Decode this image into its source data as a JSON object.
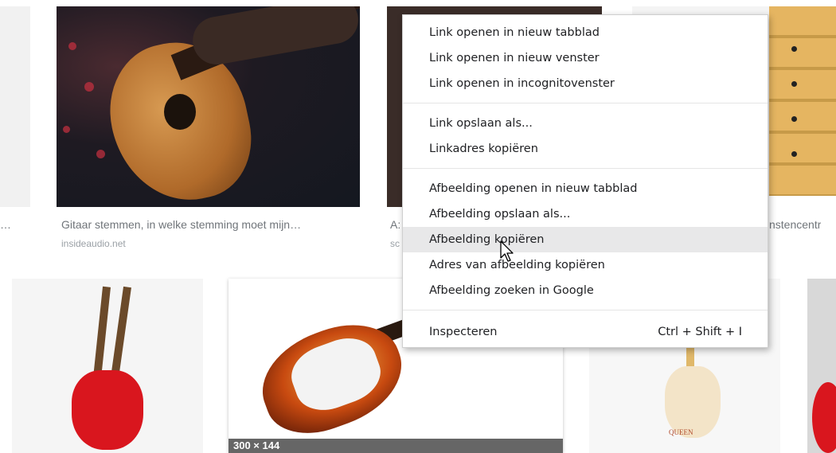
{
  "results": {
    "items": [
      {
        "caption": "…"
      },
      {
        "caption": "Gitaar stemmen, in welke stemming moet mijn…",
        "source": "insideaudio.net"
      },
      {
        "caption": "A:",
        "source": "sc"
      },
      {
        "caption": "nstencentr"
      }
    ],
    "hover_dimensions": "300 × 144",
    "queen_logo_text": "QUEEN"
  },
  "context_menu": {
    "groups": [
      [
        "Link openen in nieuw tabblad",
        "Link openen in nieuw venster",
        "Link openen in incognitovenster"
      ],
      [
        "Link opslaan als...",
        "Linkadres kopiëren"
      ],
      [
        "Afbeelding openen in nieuw tabblad",
        "Afbeelding opslaan als...",
        "Afbeelding kopiëren",
        "Adres van afbeelding kopiëren",
        "Afbeelding zoeken in Google"
      ],
      [
        "Inspecteren"
      ]
    ],
    "highlighted": "Afbeelding kopiëren",
    "inspect_shortcut": "Ctrl + Shift + I"
  },
  "icons": {
    "cursor": "arrow-cursor-icon"
  }
}
